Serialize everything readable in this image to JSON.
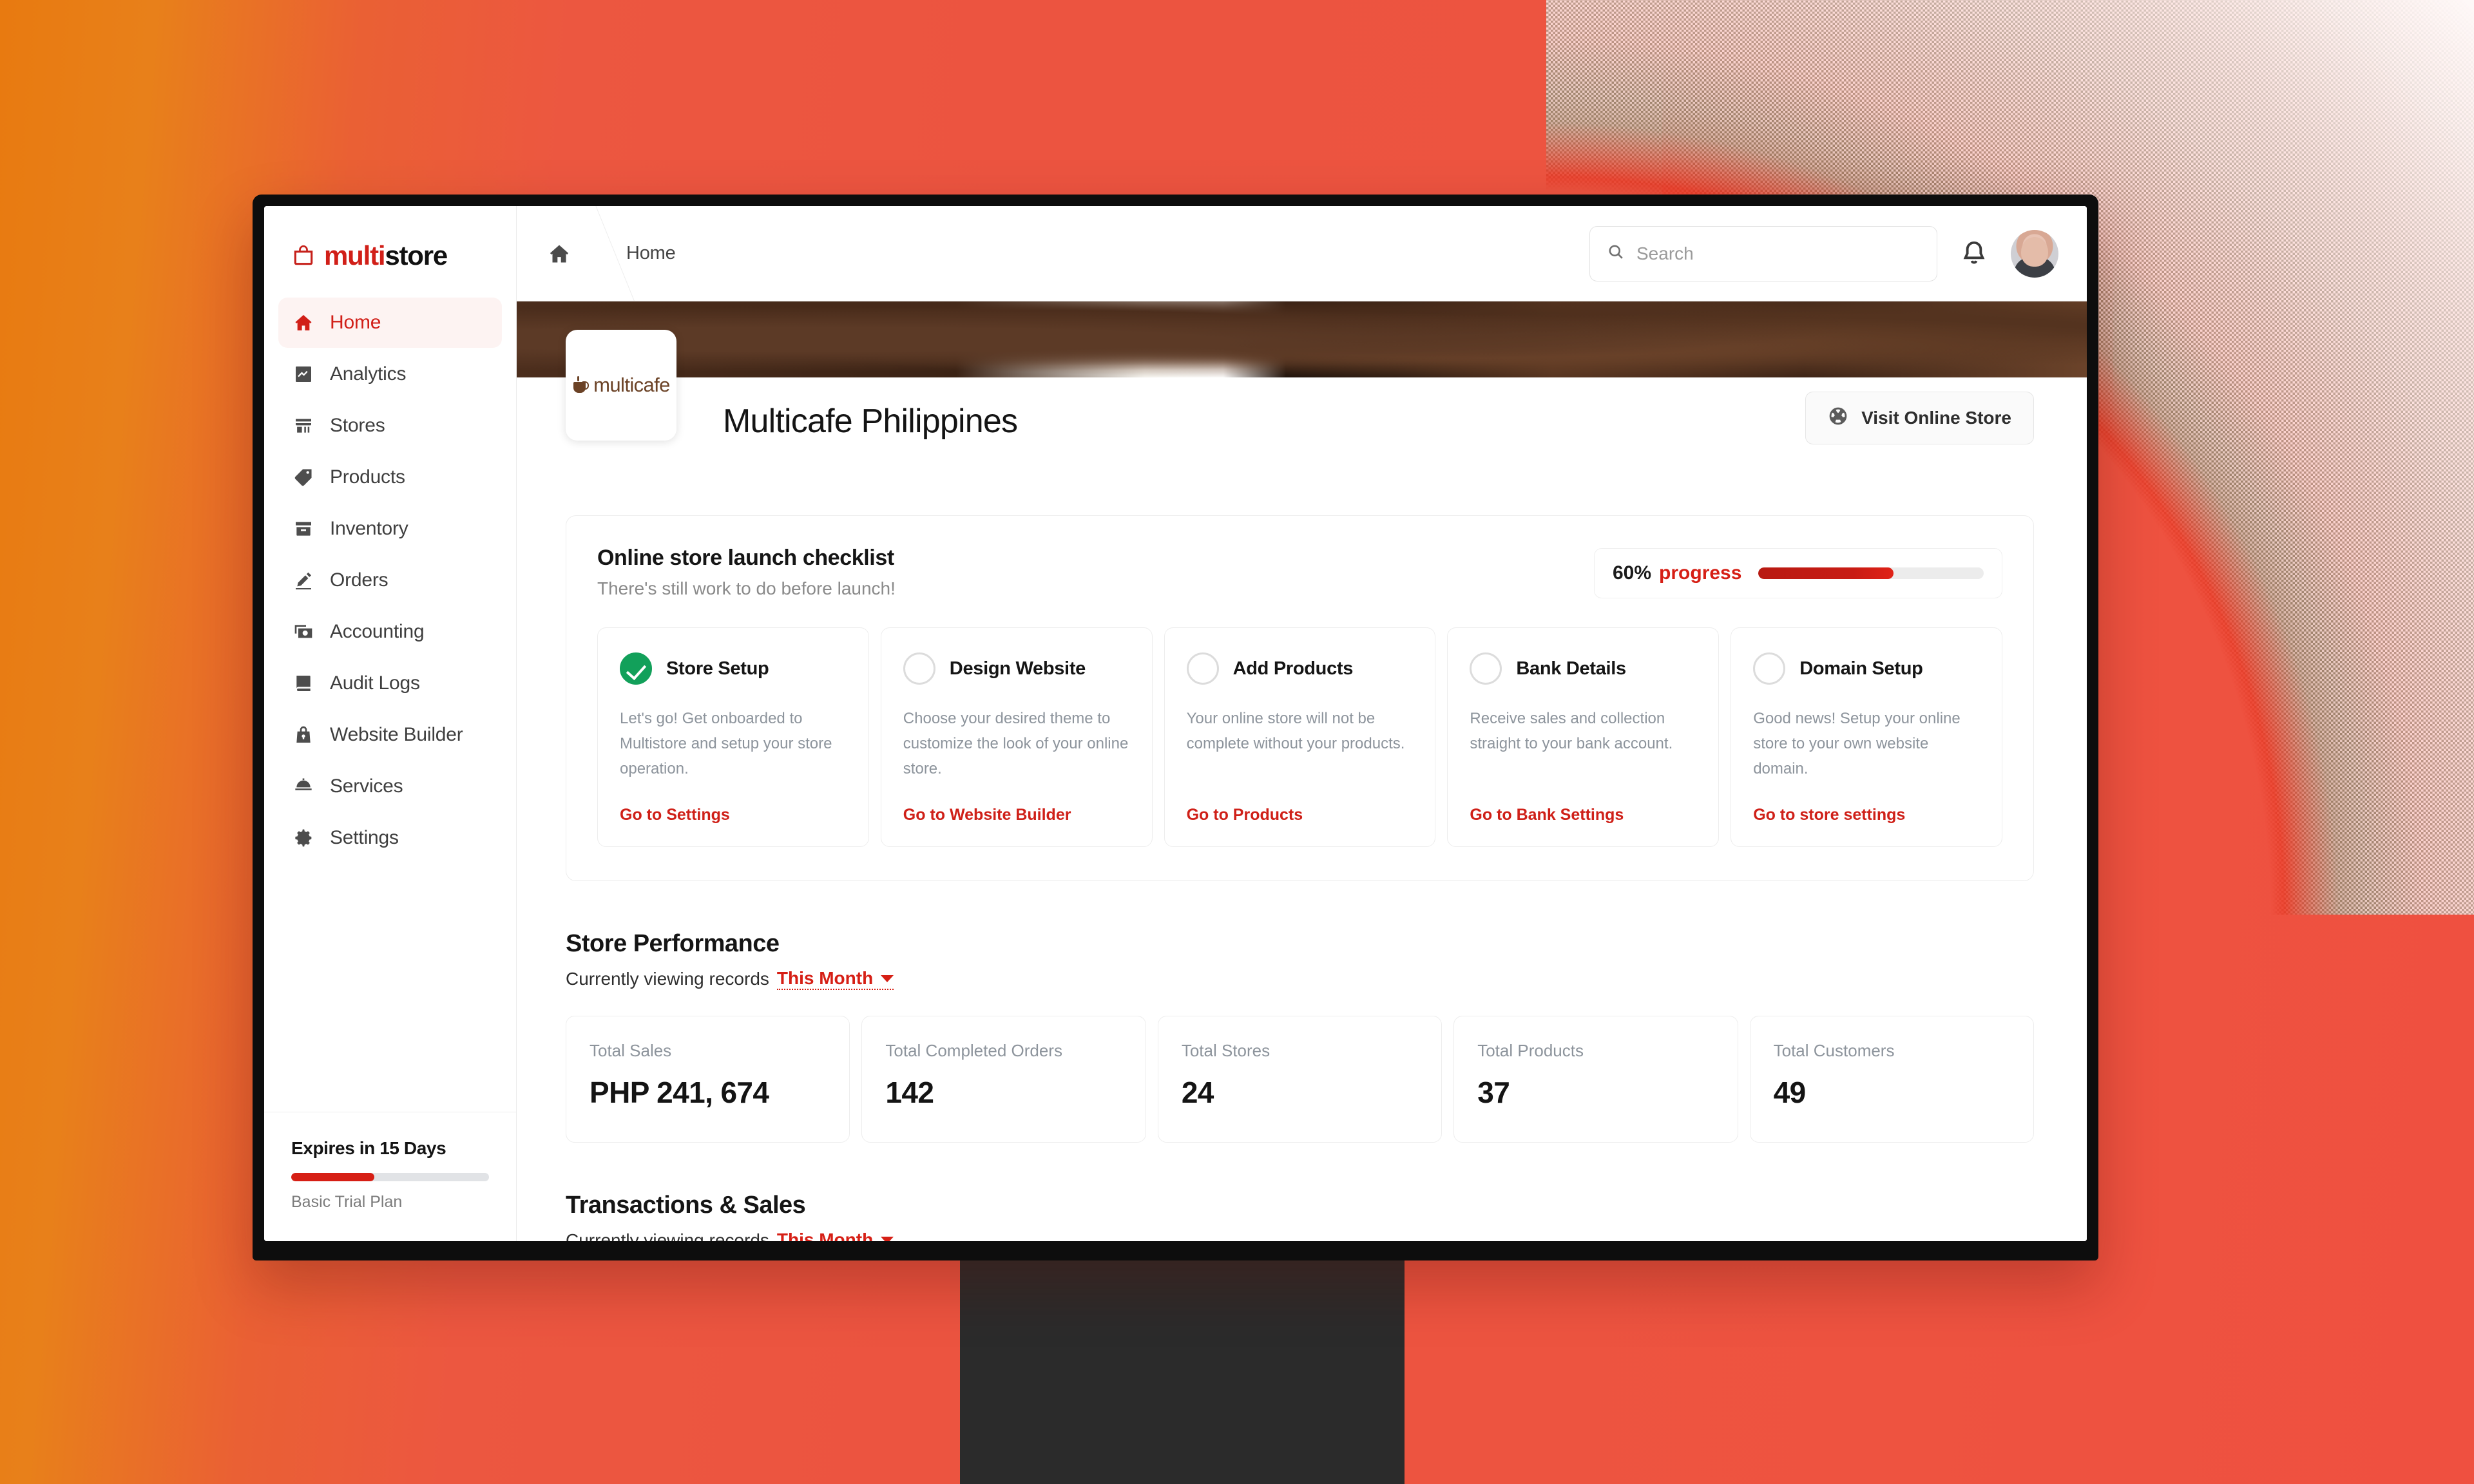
{
  "brand": {
    "part1": "multi",
    "part2": "store",
    "mark": "shopping-bag-icon"
  },
  "sidebar": {
    "items": [
      {
        "label": "Home",
        "icon": "home-icon",
        "active": true
      },
      {
        "label": "Analytics",
        "icon": "analytics-icon",
        "active": false
      },
      {
        "label": "Stores",
        "icon": "store-icon",
        "active": false
      },
      {
        "label": "Products",
        "icon": "tag-icon",
        "active": false
      },
      {
        "label": "Inventory",
        "icon": "inventory-icon",
        "active": false
      },
      {
        "label": "Orders",
        "icon": "pencil-icon",
        "active": false
      },
      {
        "label": "Accounting",
        "icon": "money-icon",
        "active": false
      },
      {
        "label": "Audit Logs",
        "icon": "book-icon",
        "active": false
      },
      {
        "label": "Website Builder",
        "icon": "lock-bag-icon",
        "active": false
      },
      {
        "label": "Services",
        "icon": "dome-icon",
        "active": false
      },
      {
        "label": "Settings",
        "icon": "gear-icon",
        "active": false
      }
    ],
    "plan": {
      "title": "Expires in 15 Days",
      "subtitle": "Basic Trial Plan",
      "progress_percent": 42
    }
  },
  "topbar": {
    "breadcrumb_home_icon": "home-icon",
    "breadcrumb": "Home",
    "search": {
      "value": "",
      "placeholder": "Search",
      "icon": "search-icon"
    },
    "notifications_icon": "bell-icon",
    "avatar": "user-avatar"
  },
  "store_header": {
    "logo_text": "multicafe",
    "title": "Multicafe Philippines",
    "visit_button": {
      "label": "Visit Online Store",
      "icon": "globe-icon"
    }
  },
  "checklist": {
    "title": "Online store launch checklist",
    "subtitle": "There's still work to do before launch!",
    "progress": {
      "percent_text": "60%",
      "word": "progress",
      "value": 60
    },
    "items": [
      {
        "title": "Store Setup",
        "description": "Let's go! Get onboarded to Multistore and setup your store operation.",
        "link": "Go to Settings",
        "completed": true
      },
      {
        "title": "Design Website",
        "description": "Choose your desired theme to customize the look of your online store.",
        "link": "Go to Website Builder",
        "completed": false
      },
      {
        "title": "Add Products",
        "description": "Your online store will not be complete without your products.",
        "link": "Go to Products",
        "completed": false
      },
      {
        "title": "Bank Details",
        "description": "Receive sales and collection straight to your bank account.",
        "link": "Go to Bank Settings",
        "completed": false
      },
      {
        "title": "Domain Setup",
        "description": "Good news! Setup your online store to your own website domain.",
        "link": "Go to store settings",
        "completed": false
      }
    ]
  },
  "store_performance": {
    "title": "Store Performance",
    "filter_prefix": "Currently viewing records",
    "filter_value": "This Month",
    "stats": [
      {
        "label": "Total Sales",
        "value": "PHP 241, 674"
      },
      {
        "label": "Total Completed Orders",
        "value": "142"
      },
      {
        "label": "Total Stores",
        "value": "24"
      },
      {
        "label": "Total Products",
        "value": "37"
      },
      {
        "label": "Total Customers",
        "value": "49"
      }
    ]
  },
  "transactions_sales": {
    "title": "Transactions & Sales",
    "filter_prefix": "Currently viewing records",
    "filter_value": "This Month"
  },
  "colors": {
    "brand_red": "#d11f18",
    "accent_red": "#d61f15",
    "success_green": "#12a05a",
    "background_orange": "#e87a10",
    "background_coral": "#ec5440",
    "monitor_bezel": "#0d0d0d"
  }
}
